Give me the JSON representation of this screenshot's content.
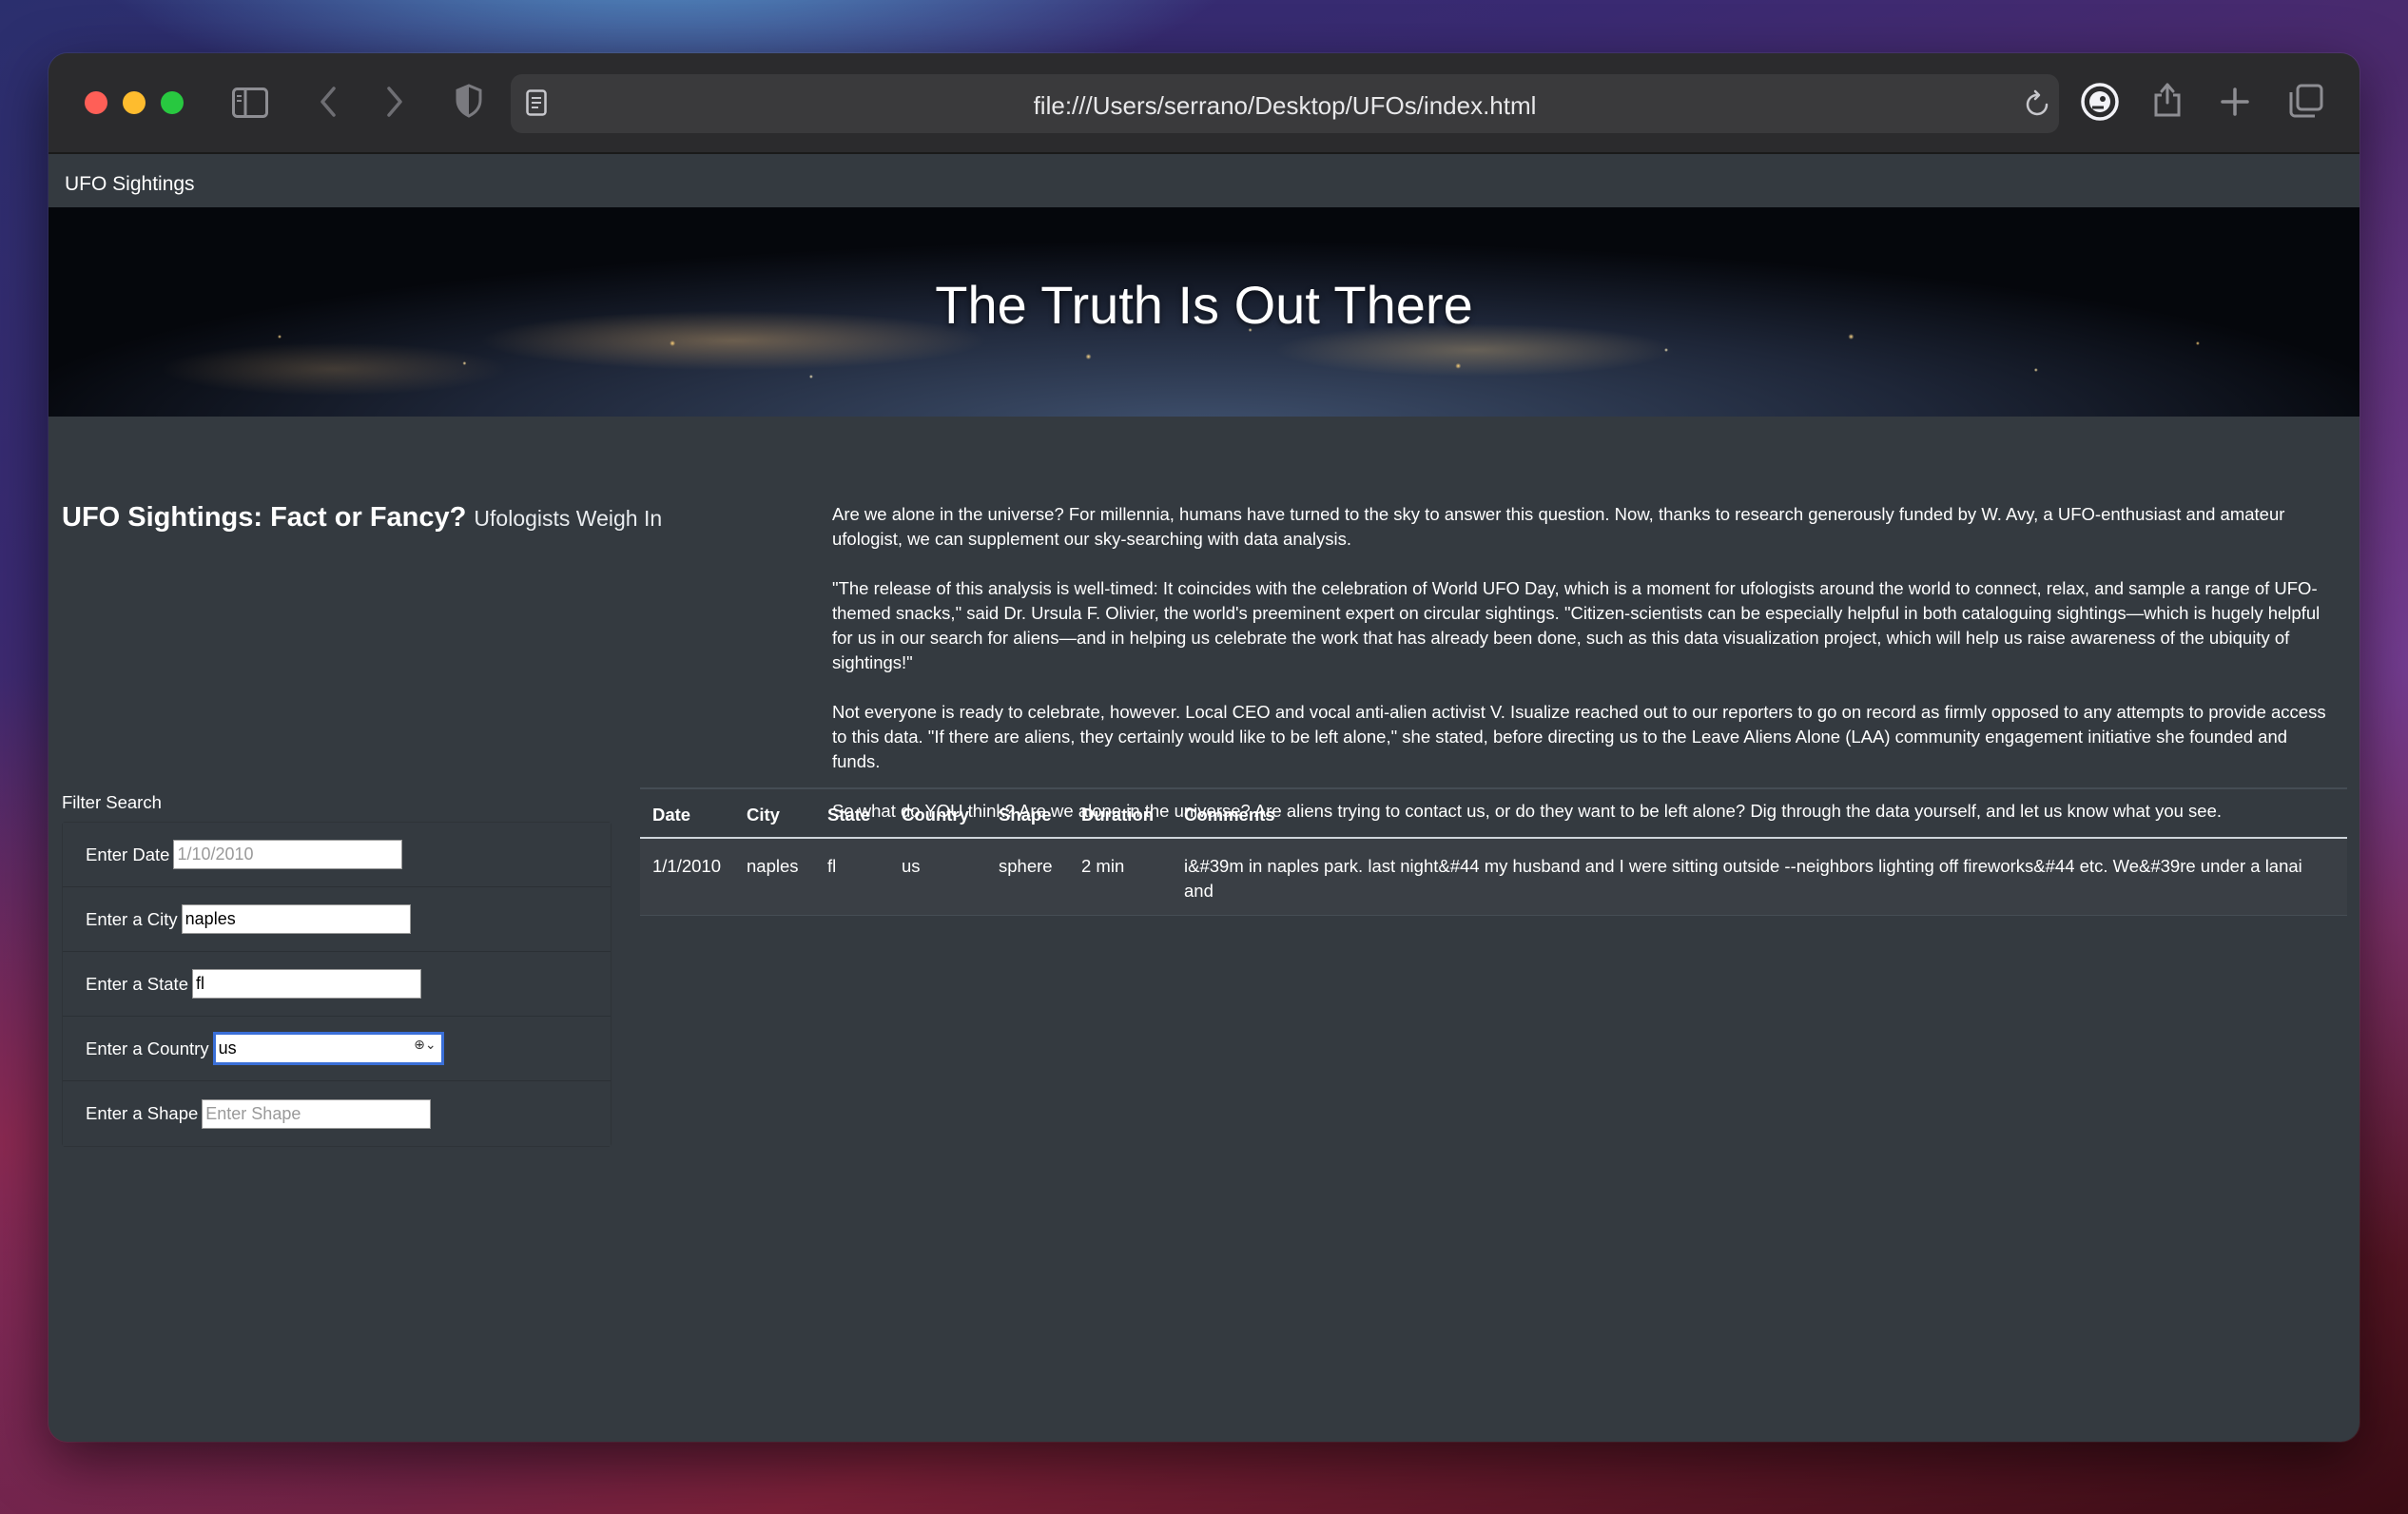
{
  "browser": {
    "url": "file:///Users/serrano/Desktop/UFOs/index.html",
    "icons": [
      "sidebar-icon",
      "back-icon",
      "forward-icon",
      "shield-icon",
      "reader-icon",
      "reload-icon",
      "duckduckgo-icon",
      "share-icon",
      "new-tab-icon",
      "tabs-overview-icon"
    ]
  },
  "navbar": {
    "brand": "UFO Sightings"
  },
  "hero": {
    "title": "The Truth Is Out There"
  },
  "article": {
    "title": "UFO Sightings: Fact or Fancy?",
    "subtitle": "Ufologists Weigh In",
    "paragraphs": [
      "Are we alone in the universe? For millennia, humans have turned to the sky to answer this question. Now, thanks to research generously funded by W. Avy, a UFO-enthusiast and amateur ufologist, we can supplement our sky-searching with data analysis.",
      "\"The release of this analysis is well-timed: It coincides with the celebration of World UFO Day, which is a moment for ufologists around the world to connect, relax, and sample a range of UFO-themed snacks,\" said Dr. Ursula F. Olivier, the world's preeminent expert on circular sightings. \"Citizen-scientists can be especially helpful in both cataloguing sightings—which is hugely helpful for us in our search for aliens—and in helping us celebrate the work that has already been done, such as this data visualization project, which will help us raise awareness of the ubiquity of sightings!\"",
      "Not everyone is ready to celebrate, however. Local CEO and vocal anti-alien activist V. Isualize reached out to our reporters to go on record as firmly opposed to any attempts to provide access to this data. \"If there are aliens, they certainly would like to be left alone,\" she stated, before directing us to the Leave Aliens Alone (LAA) community engagement initiative she founded and funds.",
      "So what do YOU think? Are we alone in the universe? Are aliens trying to contact us, or do they want to be left alone? Dig through the data yourself, and let us know what you see."
    ]
  },
  "filters": {
    "heading": "Filter Search",
    "date": {
      "label": "Enter Date",
      "value": "",
      "placeholder": "1/10/2010"
    },
    "city": {
      "label": "Enter a City",
      "value": "naples",
      "placeholder": ""
    },
    "state": {
      "label": "Enter a State",
      "value": "fl",
      "placeholder": ""
    },
    "country": {
      "label": "Enter a Country",
      "value": "us",
      "placeholder": ""
    },
    "shape": {
      "label": "Enter a Shape",
      "value": "",
      "placeholder": "Enter Shape"
    }
  },
  "table": {
    "headers": [
      "Date",
      "City",
      "State",
      "Country",
      "Shape",
      "Duration",
      "Comments"
    ],
    "rows": [
      [
        "1/1/2010",
        "naples",
        "fl",
        "us",
        "sphere",
        "2 min",
        "i&#39m in naples park. last night&#44 my husband and I were sitting outside --neighbors lighting off fireworks&#44 etc. We&#39re under a lanai and"
      ]
    ]
  }
}
